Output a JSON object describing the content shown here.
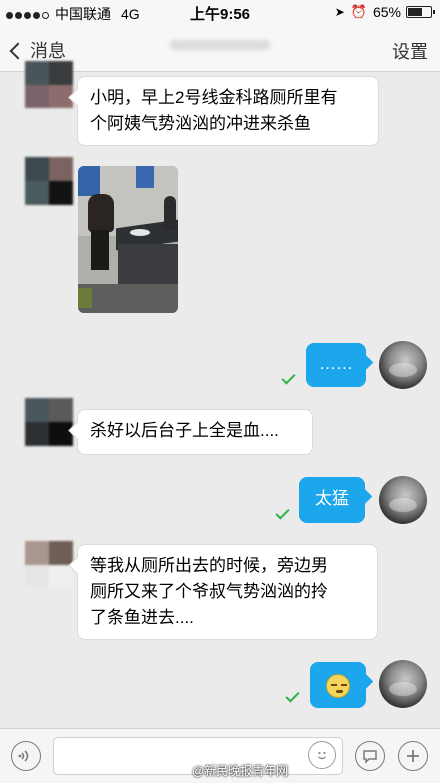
{
  "status": {
    "carrier": "中国联通",
    "network": "4G",
    "time": "上午9:56",
    "battery": "65%",
    "battery_level": 0.65
  },
  "nav": {
    "back_label": "消息",
    "settings_label": "设置"
  },
  "messages": [
    {
      "side": "left",
      "type": "text",
      "text_lines": [
        "小明，早上2号线金科路厕所里有",
        "个阿姨气势汹汹的冲进来杀鱼"
      ]
    },
    {
      "side": "left",
      "type": "image"
    },
    {
      "side": "right",
      "type": "text",
      "text": "……",
      "status": "sent"
    },
    {
      "side": "left",
      "type": "text",
      "text": "杀好以后台子上全是血...."
    },
    {
      "side": "right",
      "type": "text",
      "text": "太猛",
      "status": "sent"
    },
    {
      "side": "left",
      "type": "text",
      "text_lines": [
        "等我从厕所出去的时候，旁边男",
        "厕所又来了个爷叔气势汹汹的拎",
        "了条鱼进去...."
      ]
    },
    {
      "side": "right",
      "type": "emoji",
      "emoji": "awkward-face-emoji",
      "status": "sent"
    }
  ],
  "input": {
    "voice_icon": "voice-icon",
    "emoji_icon": "smiley-icon",
    "chat_icon": "speech-bubble-icon",
    "add_icon": "plus-icon"
  },
  "watermark": "@新民晚报青年网",
  "colors": {
    "bubble_blue": "#1ca7ec",
    "check_green": "#2db34a",
    "chat_bg": "#ebebeb"
  }
}
